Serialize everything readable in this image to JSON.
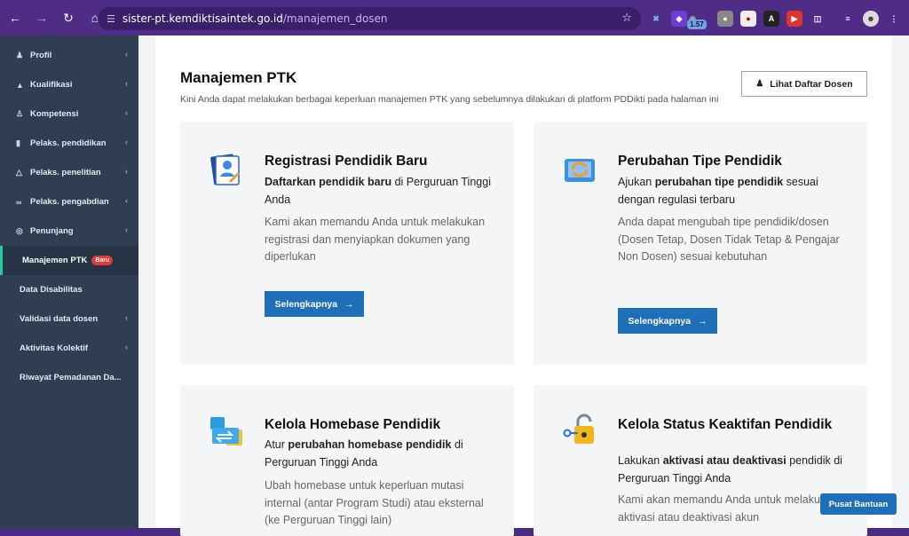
{
  "browser": {
    "url_host": "sister-pt.kemdiktisaintek.go.id",
    "url_path": "/manajemen_dosen",
    "ext_badge": "1.57"
  },
  "sidebar": {
    "items": [
      {
        "label": "Profil",
        "icon": "user-icon",
        "chevron": true
      },
      {
        "label": "Kualifikasi",
        "icon": "graduation-cap-icon",
        "chevron": true
      },
      {
        "label": "Kompetensi",
        "icon": "users-icon",
        "chevron": true
      },
      {
        "label": "Pelaks. pendidikan",
        "icon": "book-icon",
        "chevron": true
      },
      {
        "label": "Pelaks. penelitian",
        "icon": "flask-icon",
        "chevron": true
      },
      {
        "label": "Pelaks. pengabdian",
        "icon": "link-icon",
        "chevron": true
      },
      {
        "label": "Penunjang",
        "icon": "globe-icon",
        "chevron": true
      },
      {
        "label": "Manajemen PTK",
        "badge": "Baru",
        "active": true
      },
      {
        "label": "Data Disabilitas"
      },
      {
        "label": "Validasi data dosen",
        "chevron": true
      },
      {
        "label": "Aktivitas Kolektif",
        "chevron": true
      },
      {
        "label": "Riwayat Pemadanan Da..."
      }
    ]
  },
  "main": {
    "title": "Manajemen PTK",
    "subtitle": "Kini Anda dapat melakukan berbagai keperluan manajemen PTK yang sebelumnya dilakukan di platform PDDikti pada halaman ini",
    "lihat_button": "Lihat Daftar Dosen"
  },
  "cards": [
    {
      "title": "Registrasi Pendidik Baru",
      "lead_bold": "Daftarkan pendidik baru",
      "lead_rest": " di Perguruan Tinggi Anda",
      "desc": "Kami akan memandu Anda untuk melakukan registrasi dan menyiapkan dokumen yang diperlukan",
      "cta": "Selengkapnya"
    },
    {
      "title": "Perubahan Tipe Pendidik",
      "lead_pre": "Ajukan ",
      "lead_bold": "perubahan tipe pendidik",
      "lead_rest": " sesuai dengan regulasi terbaru",
      "desc": "Anda dapat mengubah tipe pendidik/dosen (Dosen Tetap, Dosen Tidak Tetap & Pengajar Non Dosen) sesuai kebutuhan",
      "cta": "Selengkapnya"
    },
    {
      "title": "Kelola Homebase Pendidik",
      "lead_pre": "Atur ",
      "lead_bold": "perubahan homebase pendidik",
      "lead_rest": " di Perguruan Tinggi Anda",
      "desc": "Ubah homebase untuk keperluan mutasi internal (antar Program Studi) atau eksternal (ke Perguruan Tinggi lain)"
    },
    {
      "title": "Kelola Status Keaktifan Pendidik",
      "lead_pre": "Lakukan ",
      "lead_bold": "aktivasi atau deaktivasi",
      "lead_rest": " pendidik di Perguruan Tinggi Anda",
      "desc": "Kami akan memandu Anda untuk melakukan aktivasi atau deaktivasi akun"
    }
  ],
  "help_button": "Pusat Bantuan",
  "colors": {
    "primary": "#1f6fb8",
    "sidebar": "#2f3e52",
    "accent": "#1dcf9a",
    "badge": "#e53935"
  }
}
